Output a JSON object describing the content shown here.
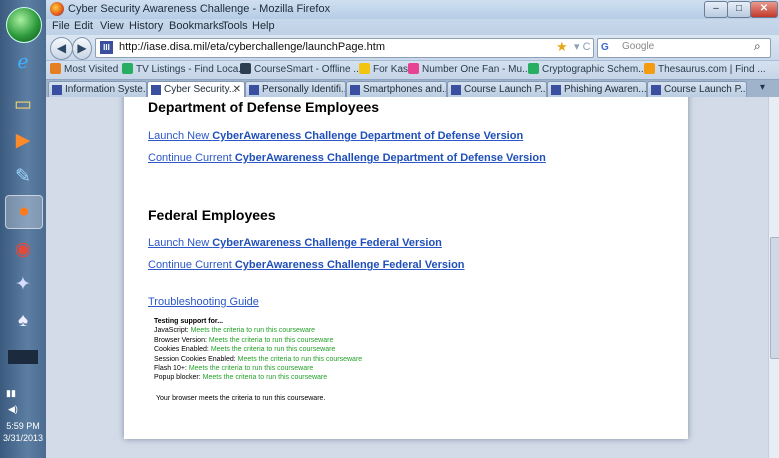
{
  "taskbar": {
    "time": "5:59 PM",
    "date": "3/31/2013"
  },
  "window": {
    "title": "Cyber Security Awareness Challenge - Mozilla Firefox",
    "min_label": "–",
    "max_label": "□",
    "close_label": "✕"
  },
  "menu": {
    "file": "File",
    "edit": "Edit",
    "view": "View",
    "history": "History",
    "bookmarks": "Bookmarks",
    "tools": "Tools",
    "help": "Help"
  },
  "toolbar": {
    "url": "http://iase.disa.mil/eta/cyberchallenge/launchPage.htm",
    "search_placeholder": "Google"
  },
  "bookmarks": [
    {
      "label": "Most Visited",
      "color": "#e67e22"
    },
    {
      "label": "TV Listings - Find Loca...",
      "color": "#27ae60"
    },
    {
      "label": "CourseSmart - Offline ...",
      "color": "#2c3e50"
    },
    {
      "label": "For Kas",
      "color": "#f1c40f"
    },
    {
      "label": "Number One Fan - Mu...",
      "color": "#e84393"
    },
    {
      "label": "Cryptographic Schem...",
      "color": "#27ae60"
    },
    {
      "label": "Thesaurus.com | Find ...",
      "color": "#f39c12"
    }
  ],
  "tabs": [
    {
      "label": "Information Syste..."
    },
    {
      "label": "Cyber Security..."
    },
    {
      "label": "Personally Identifi..."
    },
    {
      "label": "Smartphones and..."
    },
    {
      "label": "Course Launch P..."
    },
    {
      "label": "Phishing Awaren..."
    },
    {
      "label": "Course Launch P..."
    }
  ],
  "page": {
    "dod": {
      "heading": "Department of Defense Employees",
      "launch_prefix": "Launch New ",
      "launch_bold": "CyberAwareness Challenge Department of Defense Version",
      "continue_prefix": "Continue Current ",
      "continue_bold": "CyberAwareness Challenge Department of Defense Version"
    },
    "federal": {
      "heading": "Federal Employees",
      "launch_prefix": "Launch New ",
      "launch_bold": "CyberAwareness Challenge Federal Version",
      "continue_prefix": "Continue Current ",
      "continue_bold": "CyberAwareness Challenge Federal Version"
    },
    "troubleshooting": "Troubleshooting Guide",
    "support": {
      "title": "Testing support for...",
      "rows": [
        {
          "label": "JavaScript: ",
          "status": "Meets the criteria to run this courseware"
        },
        {
          "label": "Browser Version: ",
          "status": "Meets the criteria to run this courseware"
        },
        {
          "label": "Cookies Enabled: ",
          "status": "Meets the criteria to run this courseware"
        },
        {
          "label": "Session Cookies Enabled: ",
          "status": "Meets the criteria to run this courseware"
        },
        {
          "label": "Flash 10+: ",
          "status": "Meets the criteria to run this courseware"
        },
        {
          "label": "Popup blocker: ",
          "status": "Meets the criteria to run this courseware"
        }
      ],
      "summary": "Your browser meets the criteria to run this courseware."
    }
  }
}
